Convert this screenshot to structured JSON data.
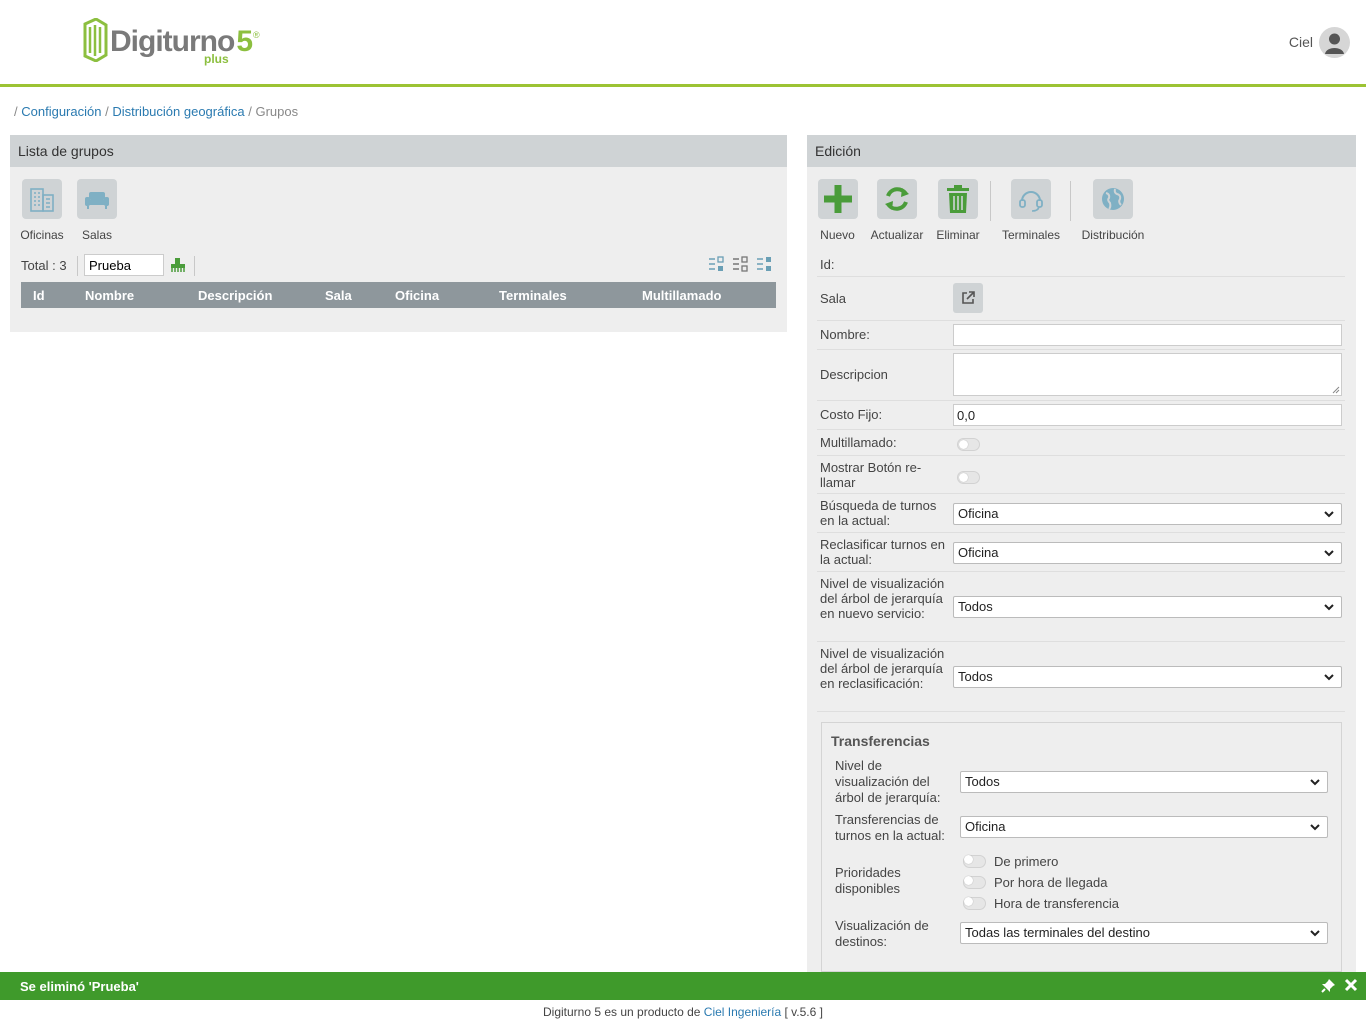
{
  "header": {
    "logo_text": "Digiturno",
    "logo_version": "5",
    "logo_sub": "plus",
    "logo_reg": "®",
    "user_name": "Ciel"
  },
  "breadcrumb": {
    "sep": "/",
    "items": [
      "Configuración",
      "Distribución geográfica",
      "Grupos"
    ]
  },
  "left_panel": {
    "title": "Lista de grupos",
    "tools": [
      {
        "label": "Oficinas",
        "icon": "building-icon"
      },
      {
        "label": "Salas",
        "icon": "sofa-icon"
      }
    ],
    "total_label": "Total :",
    "total_value": "3",
    "filter_value": "Prueba",
    "columns": [
      "Id",
      "Nombre",
      "Descripción",
      "Sala",
      "Oficina",
      "Terminales",
      "Multillamado"
    ]
  },
  "right_panel": {
    "title": "Edición",
    "tools": [
      {
        "label": "Nuevo",
        "icon": "plus-icon"
      },
      {
        "label": "Actualizar",
        "icon": "refresh-icon"
      },
      {
        "label": "Eliminar",
        "icon": "trash-icon"
      },
      {
        "label": "Terminales",
        "icon": "headset-icon"
      },
      {
        "label": "Distribución",
        "icon": "globe-icon"
      }
    ],
    "fields": {
      "id_label": "Id:",
      "sala_label": "Sala",
      "nombre_label": "Nombre:",
      "nombre_value": "",
      "descripcion_label": "Descripcion",
      "costo_label": "Costo Fijo:",
      "costo_value": "0,0",
      "multillamado_label": "Multillamado:",
      "mostrar_label": "Mostrar Botón re-llamar",
      "busqueda_label": "Búsqueda de turnos en la actual:",
      "busqueda_value": "Oficina",
      "reclasificar_label": "Reclasificar turnos en la actual:",
      "reclasificar_value": "Oficina",
      "nivel_nuevo_label": "Nivel de visualización del árbol de jerarquía en nuevo servicio:",
      "nivel_nuevo_value": "Todos",
      "nivel_reclas_label": "Nivel de visualización del árbol de jerarquía en reclasificación:",
      "nivel_reclas_value": "Todos"
    },
    "transferencias": {
      "title": "Transferencias",
      "nivel_label": "Nivel de visualización del árbol de jerarquía:",
      "nivel_value": "Todos",
      "turnos_label": "Transferencias de turnos en la actual:",
      "turnos_value": "Oficina",
      "prioridades_label": "Prioridades disponibles",
      "prioridades": [
        "De primero",
        "Por hora de llegada",
        "Hora de transferencia"
      ],
      "destinos_label": "Visualización de destinos:",
      "destinos_value": "Todas las terminales del destino"
    }
  },
  "notification": {
    "text": "Se eliminó 'Prueba'"
  },
  "footer": {
    "prefix": "Digiturno 5 es un producto de",
    "link": "Ciel Ingeniería",
    "version": "[ v.5.6 ]"
  },
  "colors": {
    "brand_green": "#8cbf3f",
    "header_line": "#9cc334",
    "notification_bg": "#3f9a2b",
    "link": "#2a7ab0",
    "grid_header": "#8e979c"
  }
}
